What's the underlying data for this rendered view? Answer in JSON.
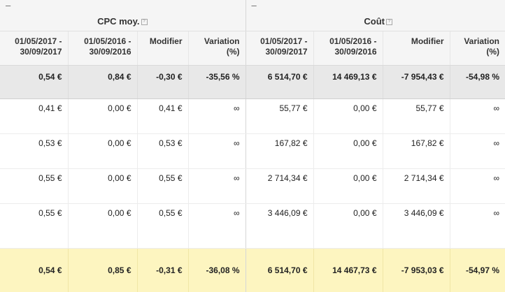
{
  "groups": [
    {
      "title": "CPC moy.",
      "collapse": "–"
    },
    {
      "title": "Coût",
      "collapse": "–"
    }
  ],
  "help_glyph": "?",
  "columns": [
    "01/05/2017 - 30/09/2017",
    "01/05/2016 - 30/09/2016",
    "Modifier",
    "Variation (%)",
    "01/05/2017 - 30/09/2017",
    "01/05/2016 - 30/09/2016",
    "Modifier",
    "Variation (%)"
  ],
  "total_row": [
    "0,54 €",
    "0,84 €",
    "-0,30 €",
    "-35,56 %",
    "6 514,70 €",
    "14 469,13 €",
    "-7 954,43 €",
    "-54,98 %"
  ],
  "rows": [
    [
      "0,41 €",
      "0,00 €",
      "0,41 €",
      "∞",
      "55,77 €",
      "0,00 €",
      "55,77 €",
      "∞"
    ],
    [
      "0,53 €",
      "0,00 €",
      "0,53 €",
      "∞",
      "167,82 €",
      "0,00 €",
      "167,82 €",
      "∞"
    ],
    [
      "0,55 €",
      "0,00 €",
      "0,55 €",
      "∞",
      "2 714,34 €",
      "0,00 €",
      "2 714,34 €",
      "∞"
    ],
    [
      "0,55 €",
      "0,00 €",
      "0,55 €",
      "∞",
      "3 446,09 €",
      "0,00 €",
      "3 446,09 €",
      "∞"
    ]
  ],
  "footer_row": [
    "0,54 €",
    "0,85 €",
    "-0,31 €",
    "-36,08 %",
    "6 514,70 €",
    "14 467,73 €",
    "-7 953,03 €",
    "-54,97 %"
  ],
  "colors": {
    "header_bg": "#f5f5f5",
    "total_bg": "#e8e8e8",
    "footer_bg": "#fdf5c0"
  }
}
